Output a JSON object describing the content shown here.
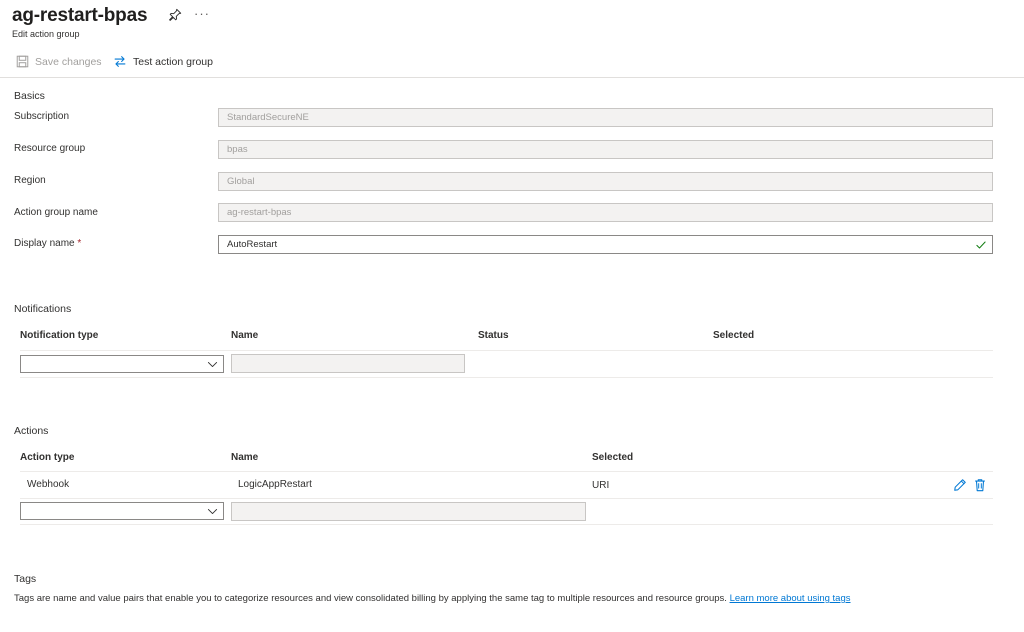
{
  "header": {
    "title": "ag-restart-bpas",
    "subtitle": "Edit action group",
    "more": "···"
  },
  "toolbar": {
    "save_label": "Save changes",
    "test_label": "Test action group"
  },
  "basics": {
    "section_label": "Basics",
    "subscription_label": "Subscription",
    "subscription_value": "StandardSecureNE",
    "resource_group_label": "Resource group",
    "resource_group_value": "bpas",
    "region_label": "Region",
    "region_value": "Global",
    "action_group_name_label": "Action group name",
    "action_group_name_value": "ag-restart-bpas",
    "display_name_label": "Display name",
    "required_marker": "*",
    "display_name_value": "AutoRestart"
  },
  "notifications": {
    "section_label": "Notifications",
    "columns": [
      "Notification type",
      "Name",
      "Status",
      "Selected"
    ]
  },
  "actions": {
    "section_label": "Actions",
    "columns": [
      "Action type",
      "Name",
      "Selected"
    ],
    "rows": [
      {
        "type": "Webhook",
        "name": "LogicAppRestart",
        "selected": "URI"
      }
    ]
  },
  "tags": {
    "section_label": "Tags",
    "description": "Tags are name and value pairs that enable you to categorize resources and view consolidated billing by applying the same tag to multiple resources and resource groups.",
    "link_text": "Learn more about using tags"
  },
  "colors": {
    "accent": "#0078d4",
    "success": "#107c10",
    "disabled": "#a19f9d"
  }
}
